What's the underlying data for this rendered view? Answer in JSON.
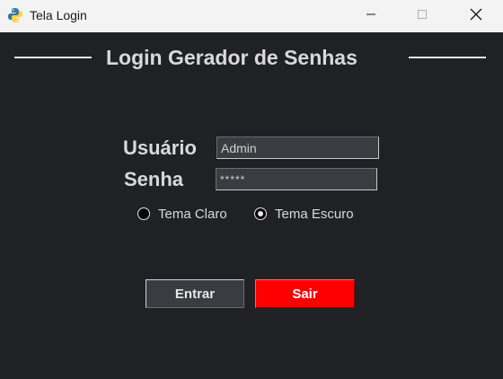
{
  "window": {
    "title": "Tela Login",
    "icon": "python-icon",
    "controls": [
      "minimize-icon",
      "maximize-icon",
      "close-icon"
    ]
  },
  "header": {
    "title": "Login Gerador de Senhas"
  },
  "form": {
    "user_label": "Usuário",
    "user_value": "Admin",
    "password_label": "Senha",
    "password_value": "*****"
  },
  "theme": {
    "options": [
      {
        "label": "Tema Claro",
        "selected": false
      },
      {
        "label": "Tema Escuro",
        "selected": true
      }
    ]
  },
  "buttons": {
    "enter_label": "Entrar",
    "exit_label": "Sair"
  },
  "colors": {
    "background": "#202124",
    "text": "#d9d9d9",
    "field_bg": "#3a3c42",
    "exit_button": "#ff0000"
  }
}
